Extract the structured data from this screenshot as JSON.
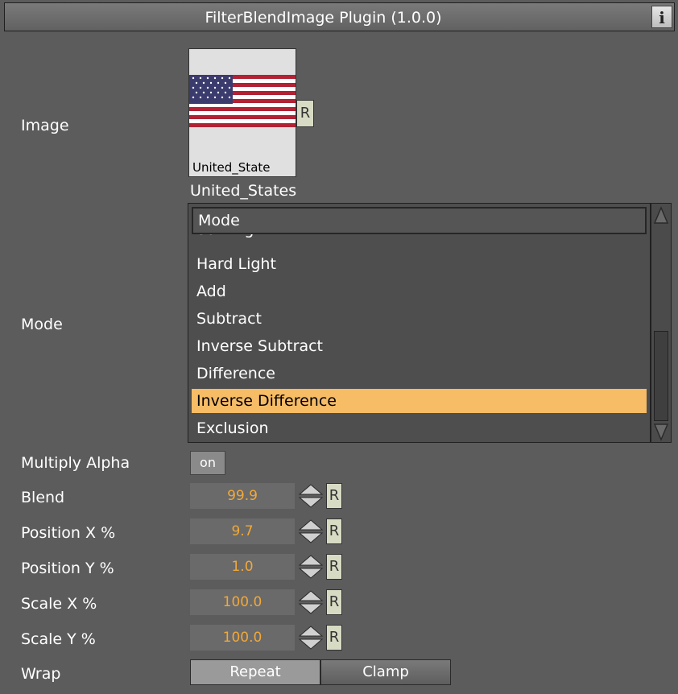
{
  "window": {
    "title": "FilterBlendImage Plugin (1.0.0)",
    "info_button": "i"
  },
  "image": {
    "label": "Image",
    "thumbnail_label": "United_State",
    "reset_label": "R",
    "name": "United_States"
  },
  "mode": {
    "label": "Mode",
    "header": "Mode",
    "partial_item": "Soft Light",
    "items": [
      "Hard Light",
      "Add",
      "Subtract",
      "Inverse Subtract",
      "Difference",
      "Inverse Difference",
      "Exclusion"
    ],
    "selected": "Inverse Difference"
  },
  "multiply_alpha": {
    "label": "Multiply Alpha",
    "value": "on"
  },
  "params": [
    {
      "label": "Blend",
      "value": "99.9",
      "reset": "R"
    },
    {
      "label": "Position X %",
      "value": "9.7",
      "reset": "R"
    },
    {
      "label": "Position Y %",
      "value": "1.0",
      "reset": "R"
    },
    {
      "label": "Scale X %",
      "value": "100.0",
      "reset": "R"
    },
    {
      "label": "Scale Y %",
      "value": "100.0",
      "reset": "R"
    }
  ],
  "wrap": {
    "label": "Wrap",
    "options": [
      "Repeat",
      "Clamp"
    ],
    "selected": "Repeat"
  },
  "colors": {
    "background": "#5c5c5c",
    "highlight": "#f6bc66",
    "value_text": "#f2a838",
    "reset_button": "#d8dbc4"
  }
}
